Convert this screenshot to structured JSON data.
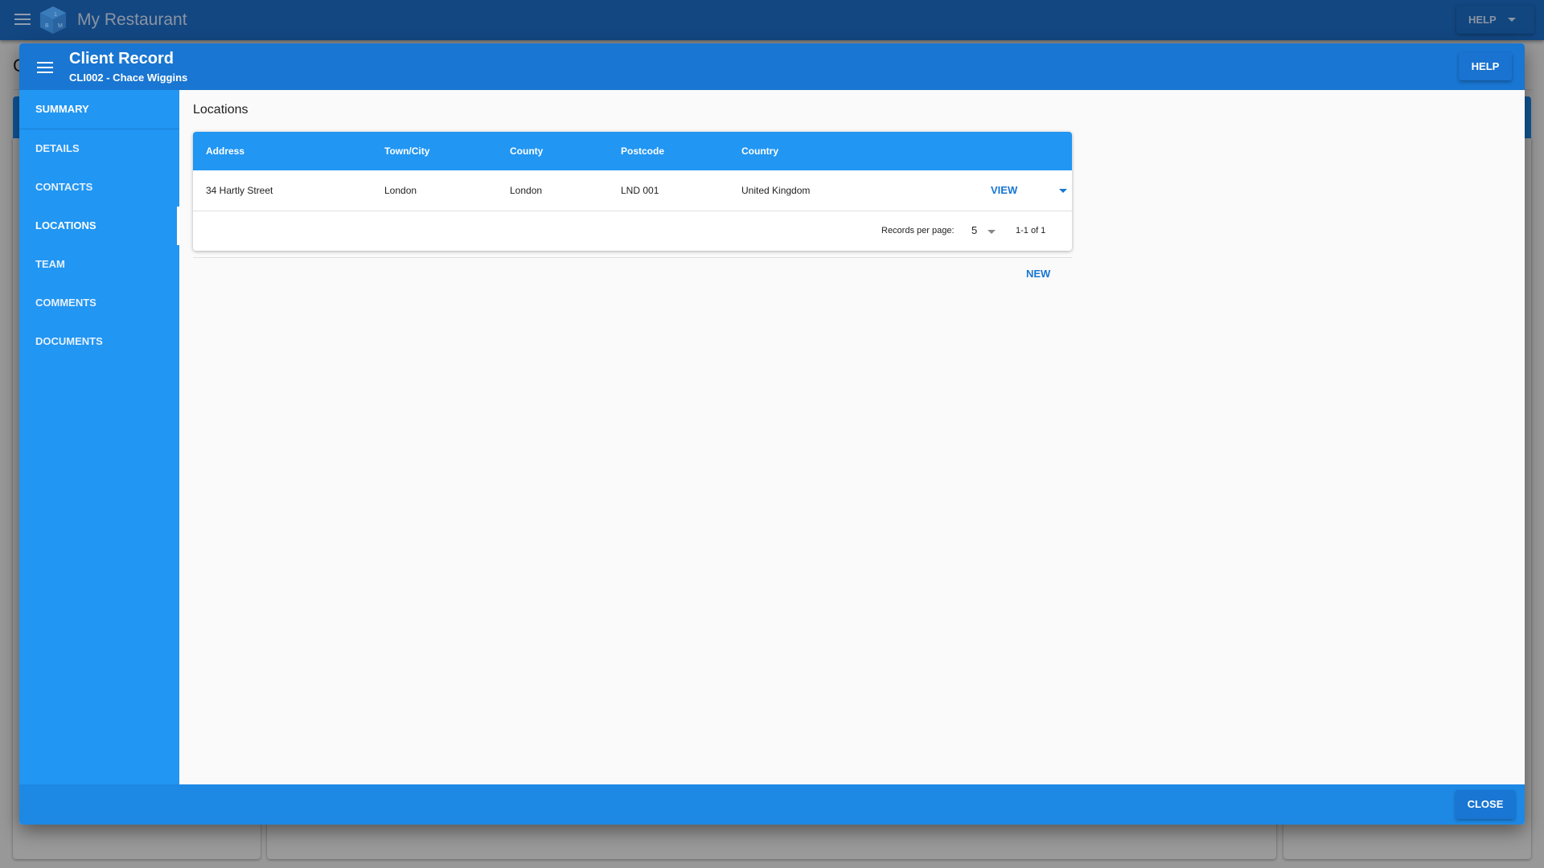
{
  "app": {
    "title": "My Restaurant",
    "help_label": "HELP",
    "background_heading": "C"
  },
  "modal": {
    "title": "Client Record",
    "subtitle": "CLI002 - Chace Wiggins",
    "help_label": "HELP",
    "close_label": "CLOSE"
  },
  "sidebar": {
    "active": "LOCATIONS",
    "items": [
      {
        "label": "SUMMARY"
      },
      {
        "label": "DETAILS"
      },
      {
        "label": "CONTACTS"
      },
      {
        "label": "LOCATIONS"
      },
      {
        "label": "TEAM"
      },
      {
        "label": "COMMENTS"
      },
      {
        "label": "DOCUMENTS"
      }
    ]
  },
  "locations": {
    "section_title": "Locations",
    "columns": [
      "Address",
      "Town/City",
      "County",
      "Postcode",
      "Country"
    ],
    "rows": [
      {
        "address": "34 Hartly Street",
        "town": "London",
        "county": "London",
        "postcode": "LND 001",
        "country": "United Kingdom",
        "action_label": "VIEW"
      }
    ],
    "pagination": {
      "records_per_page_label": "Records per page:",
      "records_per_page": "5",
      "range": "1-1 of 1"
    },
    "new_label": "NEW"
  },
  "colors": {
    "primary": "#1976d2",
    "sidebar": "#2196f3",
    "table_header": "#2196f3",
    "footer": "#1e88e5",
    "app_bar": "#134782"
  }
}
